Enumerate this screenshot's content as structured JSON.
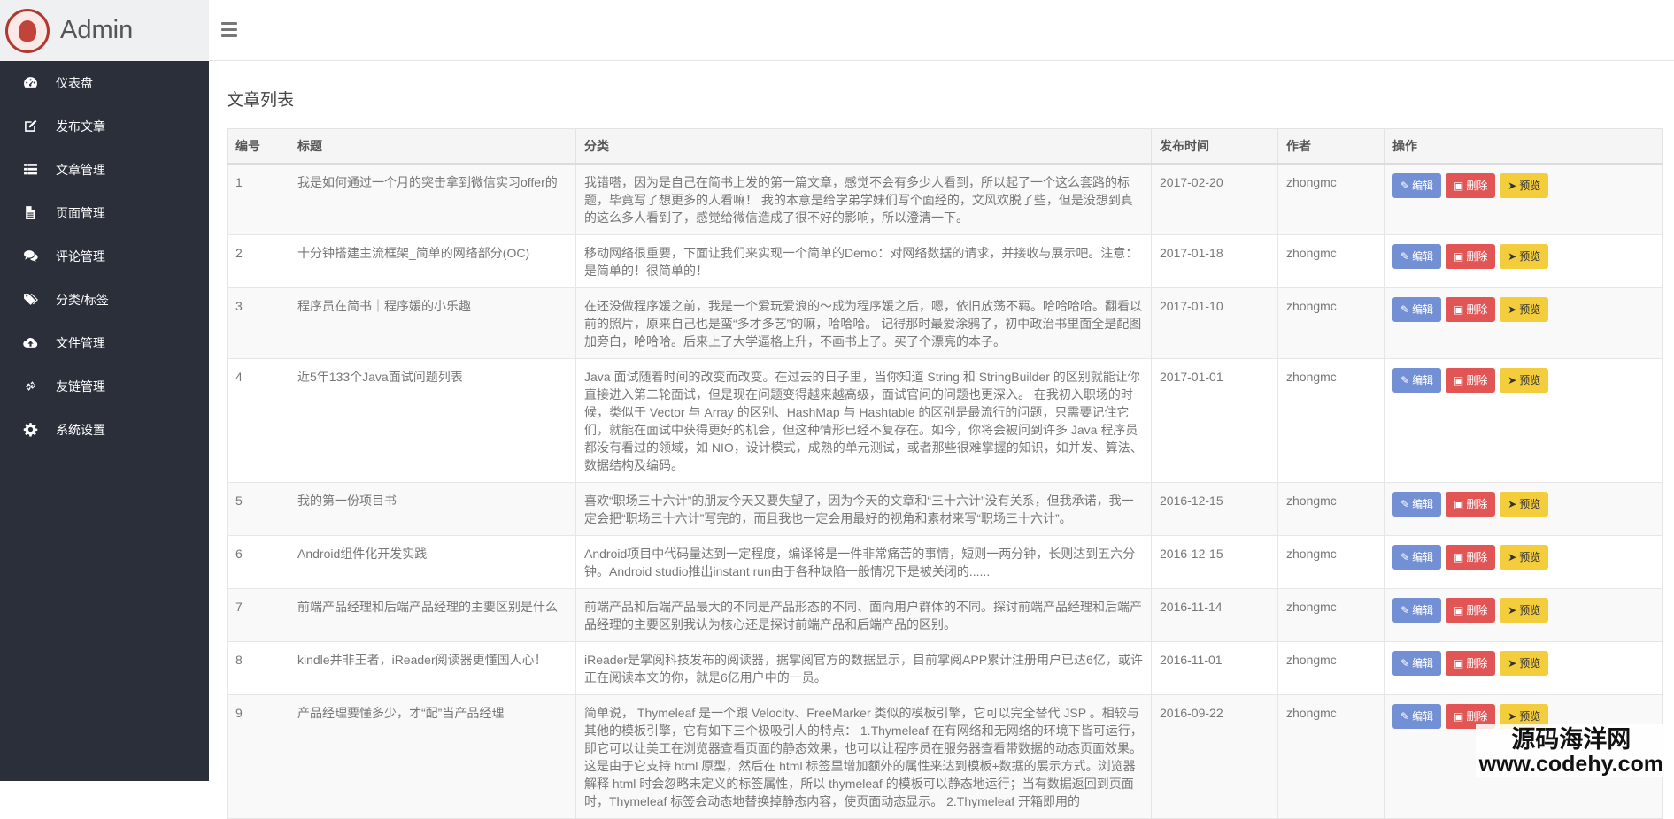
{
  "brand": {
    "title": "Admin",
    "logo_icon": "emblem-logo-icon"
  },
  "sidebar": {
    "items": [
      {
        "label": "仪表盘",
        "icon": "dashboard-icon"
      },
      {
        "label": "发布文章",
        "icon": "edit-icon"
      },
      {
        "label": "文章管理",
        "icon": "list-icon"
      },
      {
        "label": "页面管理",
        "icon": "file-icon"
      },
      {
        "label": "评论管理",
        "icon": "comments-icon"
      },
      {
        "label": "分类/标签",
        "icon": "tags-icon"
      },
      {
        "label": "文件管理",
        "icon": "cloud-upload-icon"
      },
      {
        "label": "友链管理",
        "icon": "link-icon"
      },
      {
        "label": "系统设置",
        "icon": "gear-icon"
      }
    ]
  },
  "topbar": {
    "menu_icon": "hamburger-icon"
  },
  "main": {
    "title": "文章列表",
    "columns": [
      "编号",
      "标题",
      "分类",
      "发布时间",
      "作者",
      "操作"
    ],
    "actions": {
      "edit": "编辑",
      "delete": "删除",
      "preview": "预览"
    },
    "rows": [
      {
        "id": "1",
        "title": "我是如何通过一个月的突击拿到微信实习offer的",
        "category": "我错嗒，因为是自己在简书上发的第一篇文章，感觉不会有多少人看到，所以起了一个这么套路的标题，毕竟写了想更多的人看嘛！ 我的本意是给学弟学妹们写个面经的，文风欢脱了些，但是没想到真的这么多人看到了，感觉给微信造成了很不好的影响，所以澄清一下。",
        "date": "2017-02-20",
        "author": "zhongmc"
      },
      {
        "id": "2",
        "title": "十分钟搭建主流框架_简单的网络部分(OC)",
        "category": "移动网络很重要，下面让我们来实现一个简单的Demo：对网络数据的请求，并接收与展示吧。注意：是简单的！很简单的！",
        "date": "2017-01-18",
        "author": "zhongmc"
      },
      {
        "id": "3",
        "title": "程序员在简书｜程序媛的小乐趣",
        "category": "在还没做程序媛之前，我是一个爱玩爱浪的～成为程序媛之后，嗯，依旧放荡不羁。哈哈哈哈。翻看以前的照片，原来自己也是蛮“多才多艺”的嘛，哈哈哈。 记得那时最爱涂鸦了，初中政治书里面全是配图加旁白，哈哈哈。后来上了大学逼格上升，不画书上了。买了个漂亮的本子。",
        "date": "2017-01-10",
        "author": "zhongmc"
      },
      {
        "id": "4",
        "title": "近5年133个Java面试问题列表",
        "category": "Java 面试随着时间的改变而改变。在过去的日子里，当你知道 String 和 StringBuilder 的区别就能让你直接进入第二轮面试，但是现在问题变得越来越高级，面试官问的问题也更深入。 在我初入职场的时候，类似于 Vector 与 Array 的区别、HashMap 与 Hashtable 的区别是最流行的问题，只需要记住它们，就能在面试中获得更好的机会，但这种情形已经不复存在。如今，你将会被问到许多 Java 程序员都没有看过的领域，如 NIO，设计模式，成熟的单元测试，或者那些很难掌握的知识，如并发、算法、数据结构及编码。",
        "date": "2017-01-01",
        "author": "zhongmc"
      },
      {
        "id": "5",
        "title": "我的第一份项目书",
        "category": "喜欢“职场三十六计”的朋友今天又要失望了，因为今天的文章和“三十六计”没有关系，但我承诺，我一定会把“职场三十六计”写完的，而且我也一定会用最好的视角和素材来写“职场三十六计”。",
        "date": "2016-12-15",
        "author": "zhongmc"
      },
      {
        "id": "6",
        "title": "Android组件化开发实践",
        "category": "Android项目中代码量达到一定程度，编译将是一件非常痛苦的事情，短则一两分钟，长则达到五六分钟。Android studio推出instant run由于各种缺陷一般情况下是被关闭的......",
        "date": "2016-12-15",
        "author": "zhongmc"
      },
      {
        "id": "7",
        "title": "前端产品经理和后端产品经理的主要区别是什么",
        "category": "前端产品和后端产品最大的不同是产品形态的不同、面向用户群体的不同。探讨前端产品经理和后端产品经理的主要区别我认为核心还是探讨前端产品和后端产品的区别。",
        "date": "2016-11-14",
        "author": "zhongmc"
      },
      {
        "id": "8",
        "title": "kindle并非王者，iReader阅读器更懂国人心！",
        "category": "iReader是掌阅科技发布的阅读器，据掌阅官方的数据显示，目前掌阅APP累计注册用户已达6亿，或许正在阅读本文的你，就是6亿用户中的一员。",
        "date": "2016-11-01",
        "author": "zhongmc"
      },
      {
        "id": "9",
        "title": "产品经理要懂多少，才“配”当产品经理",
        "category": "简单说， Thymeleaf 是一个跟 Velocity、FreeMarker 类似的模板引擎，它可以完全替代 JSP 。相较与其他的模板引擎，它有如下三个极吸引人的特点： 1.Thymeleaf 在有网络和无网络的环境下皆可运行，即它可以让美工在浏览器查看页面的静态效果，也可以让程序员在服务器查看带数据的动态页面效果。这是由于它支持 html 原型，然后在 html 标签里增加额外的属性来达到模板+数据的展示方式。浏览器解释 html 时会忽略未定义的标签属性，所以 thymeleaf 的模板可以静态地运行；当有数据返回到页面时，Thymeleaf 标签会动态地替换掉静态内容，使页面动态显示。 2.Thymeleaf 开箱即用的",
        "date": "2016-09-22",
        "author": "zhongmc"
      }
    ]
  },
  "watermark": {
    "line1": "源码海洋网",
    "line2": "www.codehy.com"
  }
}
